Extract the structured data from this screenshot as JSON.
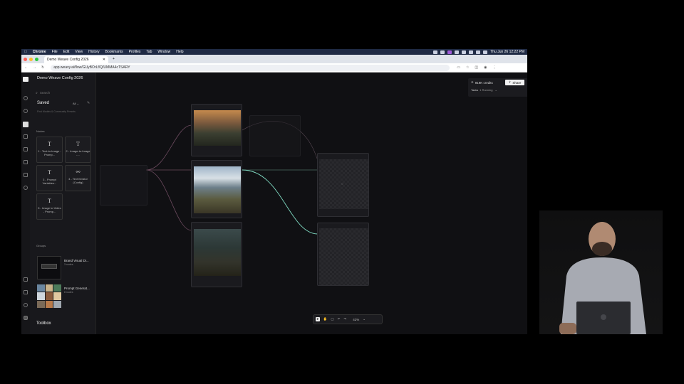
{
  "menubar": {
    "app": "Chrome",
    "items": [
      "File",
      "Edit",
      "View",
      "History",
      "Bookmarks",
      "Profiles",
      "Tab",
      "Window",
      "Help"
    ],
    "datetime": "Thu Jun 26  12:22 PM"
  },
  "browser": {
    "tab_title": "Demo Weave Config 2026",
    "url": "app.weavy.ai/flow/GUyBOrLf/Q/UMMA4cTSARY"
  },
  "app": {
    "project_title": "Demo Weave Config 2026",
    "search_placeholder": "Search",
    "saved_label": "Saved",
    "saved_filter": "All",
    "saved_hint": "Find Models & Community Presets",
    "nodes_label": "Nodes",
    "node_cards": [
      {
        "icon": "T",
        "label": "1 - Text-to-Image - Promp..."
      },
      {
        "icon": "T",
        "label": "2 - Image-to-Image -..."
      },
      {
        "icon": "T",
        "label": "3 - Prompt Variables..."
      },
      {
        "icon": "link",
        "label": "4 - Text Iterator (Config)"
      },
      {
        "icon": "T",
        "label": "5 - Image to Video - Promp..."
      }
    ],
    "groups_label": "Groups",
    "groups": [
      {
        "name": "Brand Visual Di...",
        "count": "3 nodes"
      },
      {
        "name": "Prompt Generat...",
        "count": "8 nodes"
      }
    ],
    "toolbox_label": "Toolbox",
    "credits": "919K credits",
    "share_label": "Share",
    "tasks_label": "Tasks",
    "tasks_status": "1 Running",
    "zoom": "42%"
  }
}
